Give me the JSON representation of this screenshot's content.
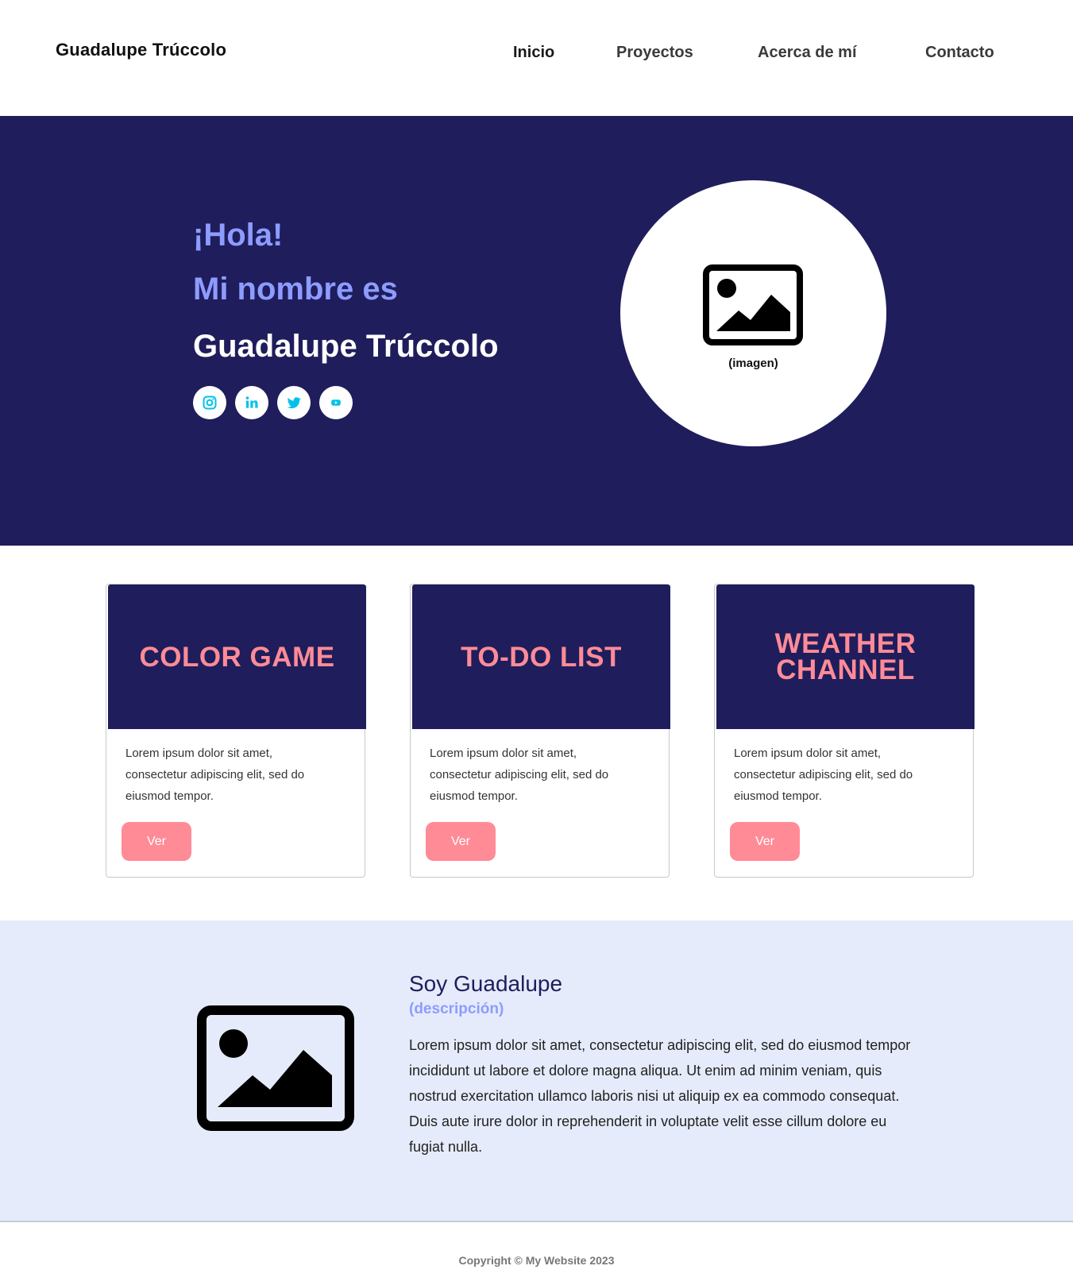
{
  "header": {
    "brand": "Guadalupe Trúccolo",
    "nav": [
      {
        "label": "Inicio"
      },
      {
        "label": "Proyectos"
      },
      {
        "label": "Acerca de mí"
      },
      {
        "label": "Contacto"
      }
    ]
  },
  "hero": {
    "greeting": "¡Hola!",
    "intro": "Mi nombre es",
    "name": "Guadalupe Trúccolo",
    "socials": [
      "instagram-icon",
      "linkedin-icon",
      "twitter-icon",
      "youtube-icon"
    ],
    "image_caption": "(imagen)"
  },
  "projects": [
    {
      "title_lines": [
        "COLOR GAME"
      ],
      "text": "Lorem ipsum dolor sit amet, consectetur adipiscing elit, sed do eiusmod tempor.",
      "button": "Ver"
    },
    {
      "title_lines": [
        "TO-DO LIST"
      ],
      "text": "Lorem ipsum dolor sit amet, consectetur adipiscing elit, sed do eiusmod tempor.",
      "button": "Ver"
    },
    {
      "title_lines": [
        "WEATHER",
        "CHANNEL"
      ],
      "text": "Lorem ipsum dolor sit amet, consectetur adipiscing elit, sed do eiusmod tempor.",
      "button": "Ver"
    }
  ],
  "about": {
    "title": "Soy Guadalupe",
    "subtitle": "(descripción)",
    "text": "Lorem ipsum dolor sit amet, consectetur adipiscing elit, sed do eiusmod tempor incididunt ut labore et dolore magna aliqua. Ut enim ad minim veniam, quis nostrud exercitation ullamco laboris nisi ut aliquip ex ea commodo consequat. Duis aute irure dolor in reprehenderit in voluptate velit esse cillum dolore eu fugiat nulla."
  },
  "footer": {
    "copyright": "Copyright © My Website 2023"
  },
  "colors": {
    "navy": "#1f1d5c",
    "periwinkle": "#8d9cff",
    "pink": "#ff8b97",
    "light_blue_bg": "#e5ebfa",
    "social_cyan": "#00c2e8"
  }
}
